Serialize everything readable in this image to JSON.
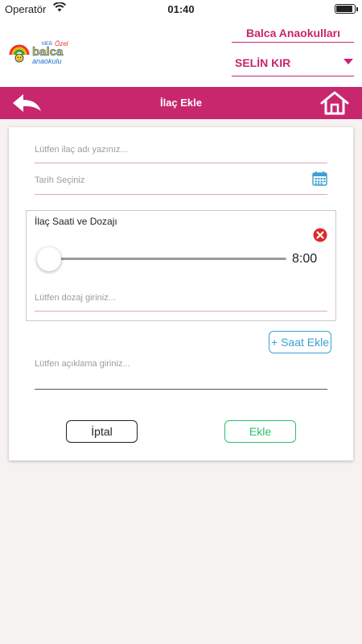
{
  "status_bar": {
    "carrier": "Operatör",
    "time": "01:40",
    "battery_level": 0.92
  },
  "header": {
    "logo": {
      "top_text": "Özel",
      "brand": "balca",
      "sub_text": "anaokulu"
    },
    "school_name": "Balca Anaokulları",
    "user_name": "SELİN KIR"
  },
  "nav": {
    "title": "İlaç Ekle",
    "back_icon": "back-arrow-icon",
    "home_icon": "home-icon"
  },
  "form": {
    "medicine_name_placeholder": "Lütfen ilaç adı yazınız...",
    "date_placeholder": "Tarih Seçiniz",
    "dose_section": {
      "title": "İlaç Saati ve Dozajı",
      "time_value": "8:00",
      "slider_position": 0,
      "dose_placeholder": "Lütfen dozaj giriniz..."
    },
    "add_time_label": "+ Saat Ekle",
    "description_placeholder": "Lütfen açıklama giriniz...",
    "cancel_label": "İptal",
    "submit_label": "Ekle"
  },
  "colors": {
    "brand": "#c8266d",
    "input_line": "#e3a6ba",
    "accent_blue": "#3aa0d4",
    "success_green": "#2bbf6a",
    "remove_red": "#e02828"
  }
}
